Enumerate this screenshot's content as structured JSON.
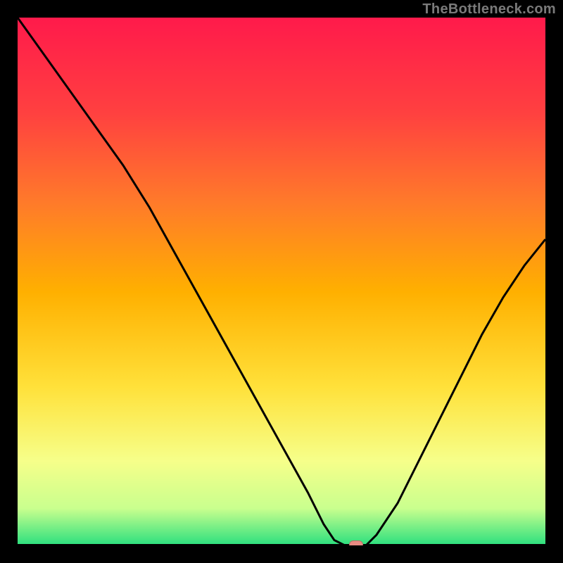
{
  "watermark": "TheBottleneck.com",
  "chart_data": {
    "type": "line",
    "title": "",
    "xlabel": "",
    "ylabel": "",
    "xlim": [
      0,
      100
    ],
    "ylim": [
      0,
      100
    ],
    "gradient_colors": {
      "top": "#ff1a4b",
      "upper_mid": "#ff6a2a",
      "mid": "#ffb000",
      "lower_mid": "#ffe13a",
      "lower": "#f6ff8a",
      "near_bottom": "#c9ff8e",
      "bottom": "#2adf7e"
    },
    "curve": {
      "x": [
        0,
        5,
        10,
        15,
        20,
        25,
        30,
        35,
        40,
        45,
        50,
        55,
        58,
        60,
        62,
        64,
        66,
        68,
        72,
        76,
        80,
        84,
        88,
        92,
        96,
        100
      ],
      "y": [
        100,
        93,
        86,
        79,
        72,
        64,
        55,
        46,
        37,
        28,
        19,
        10,
        4,
        1,
        0,
        0,
        0,
        2,
        8,
        16,
        24,
        32,
        40,
        47,
        53,
        58
      ]
    },
    "marker": {
      "x": 64,
      "y": 0,
      "width_pct": 2.5
    }
  }
}
